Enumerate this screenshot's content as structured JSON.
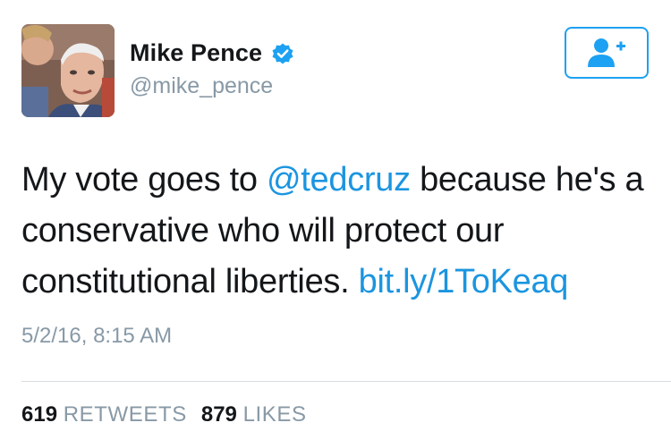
{
  "user": {
    "display_name": "Mike Pence",
    "handle": "@mike_pence",
    "verified": true,
    "avatar_icon": "profile-photo"
  },
  "follow_button": {
    "icon": "follow-user-plus-icon",
    "color": "#1da1f2"
  },
  "tweet": {
    "text_before_mention": "My vote goes to ",
    "mention": "@tedcruz",
    "text_after_mention": " because he's a conservative who will protect our constitutional liberties. ",
    "link": "bit.ly/1ToKeaq",
    "timestamp": "5/2/16, 8:15 AM"
  },
  "stats": {
    "retweets_count": "619",
    "retweets_label": "RETWEETS",
    "likes_count": "879",
    "likes_label": "LIKES"
  },
  "colors": {
    "link": "#1b95e0",
    "muted": "#8899a6",
    "text": "#14171a",
    "verified": "#1da1f2"
  }
}
